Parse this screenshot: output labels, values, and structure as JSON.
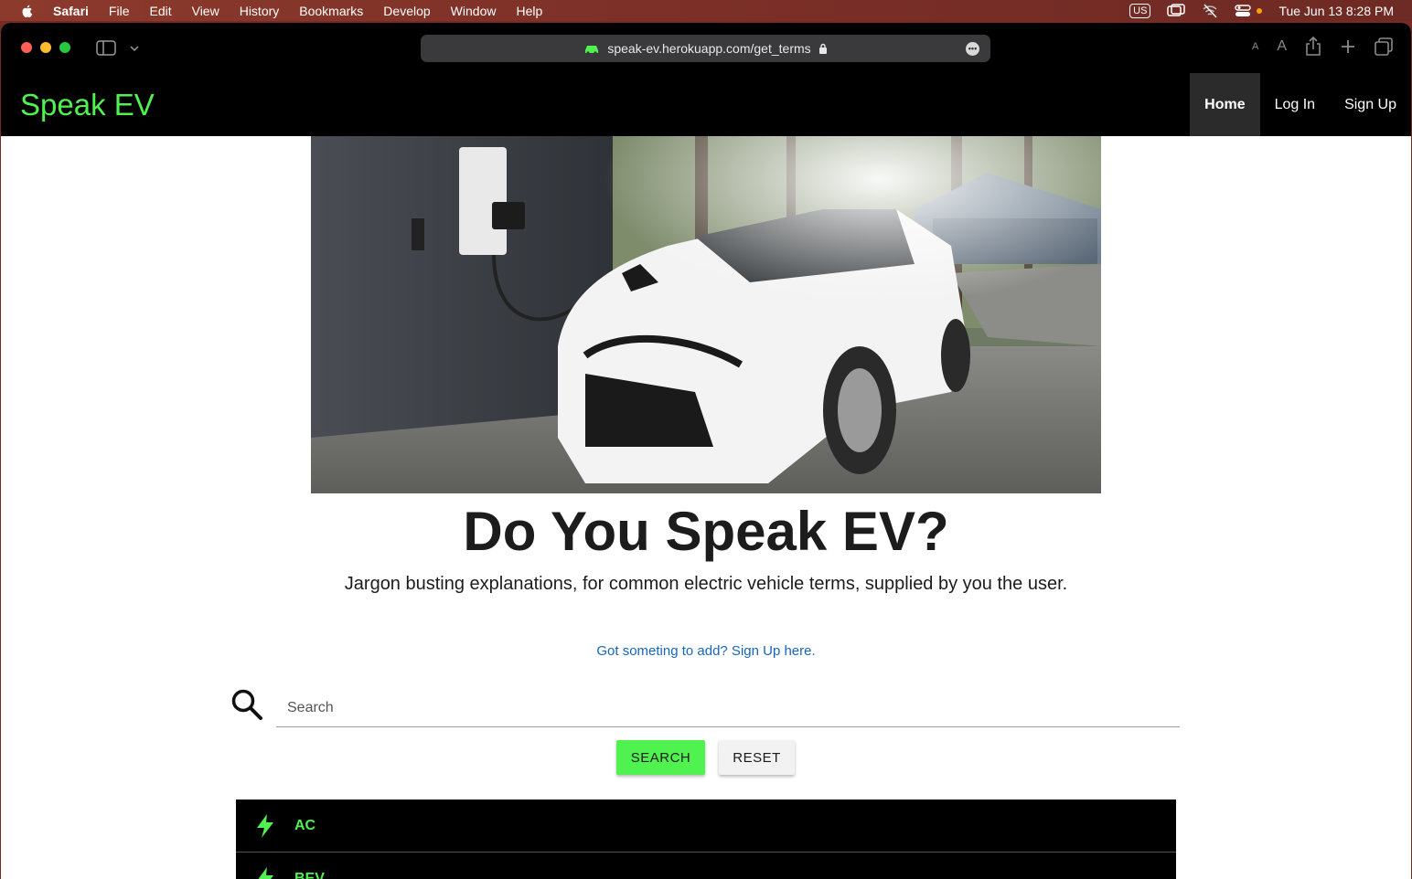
{
  "menubar": {
    "app": "Safari",
    "items": [
      "File",
      "Edit",
      "View",
      "History",
      "Bookmarks",
      "Develop",
      "Window",
      "Help"
    ],
    "keyboard": "US",
    "datetime": "Tue Jun 13  8:28 PM"
  },
  "browser": {
    "url": "speak-ev.herokuapp.com/get_terms",
    "text_size_small": "A",
    "text_size_large": "A"
  },
  "site": {
    "brand": "Speak EV",
    "nav": {
      "home": "Home",
      "login": "Log In",
      "signup": "Sign Up"
    },
    "headline": "Do You Speak EV?",
    "subhead": "Jargon busting explanations, for common electric vehicle terms, supplied by you the user.",
    "signup_link": "Got someting to add? Sign Up here.",
    "search": {
      "placeholder": "Search",
      "value": ""
    },
    "buttons": {
      "search": "SEARCH",
      "reset": "RESET"
    },
    "terms": [
      "AC",
      "BEV"
    ]
  },
  "colors": {
    "brand_green": "#4ff24f",
    "link_blue": "#1565c0",
    "nav_bg": "#000000"
  }
}
